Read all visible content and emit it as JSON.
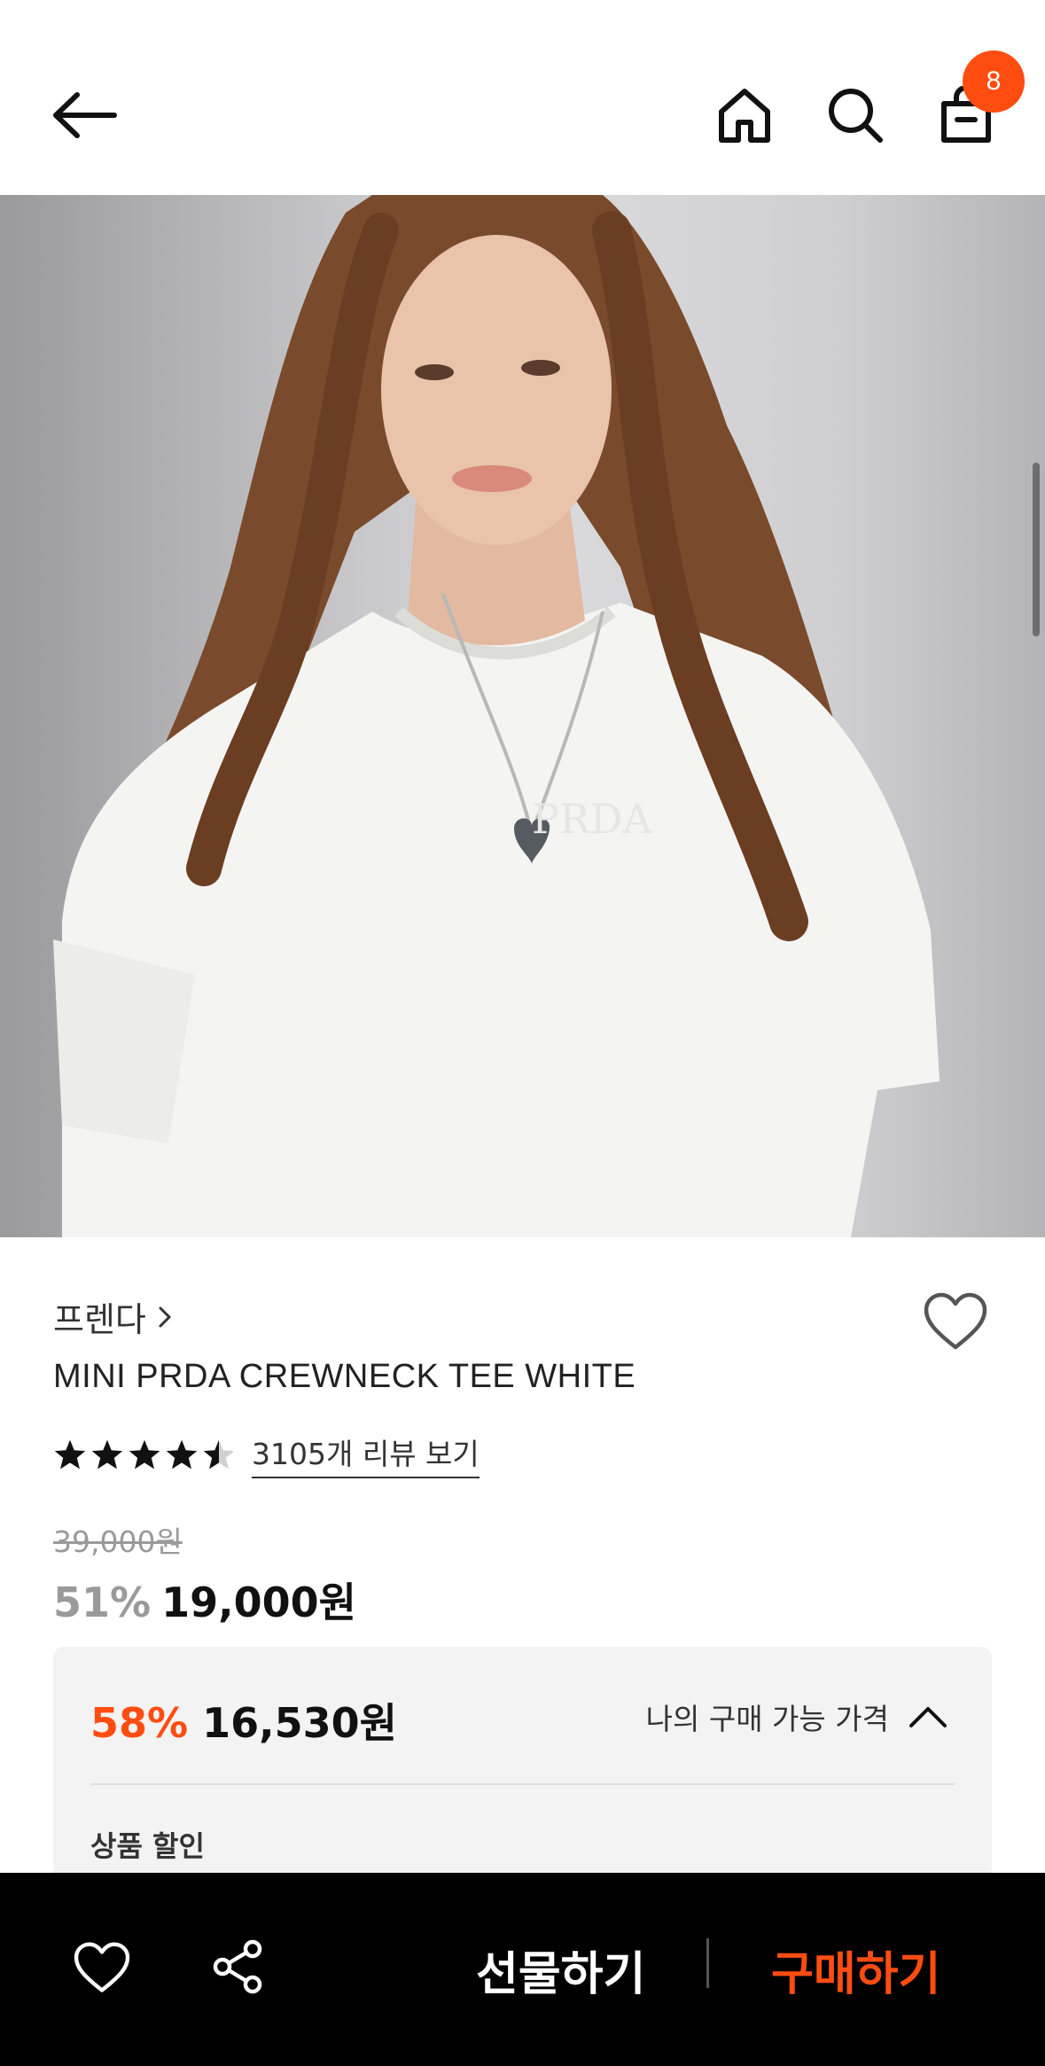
{
  "header": {
    "icons": [
      "back-arrow-icon",
      "home-icon",
      "search-icon",
      "shopping-bag-icon"
    ],
    "cart_count": "8"
  },
  "product": {
    "brand": "프렌다",
    "title": "MINI PRDA CREWNECK TEE WHITE",
    "rating": 4.5,
    "review_link": "3105개 리뷰 보기",
    "original_price": "39,000원",
    "discount": "51%",
    "price": "19,000원"
  },
  "my_price": {
    "discount": "58%",
    "price": "16,530원",
    "label": "나의 구매 가능 가격",
    "section_label": "상품 할인"
  },
  "bottom_bar": {
    "gift_label": "선물하기",
    "buy_label": "구매하기"
  },
  "colors": {
    "accent": "#ff4d12",
    "bottom_bar": "#000000"
  }
}
